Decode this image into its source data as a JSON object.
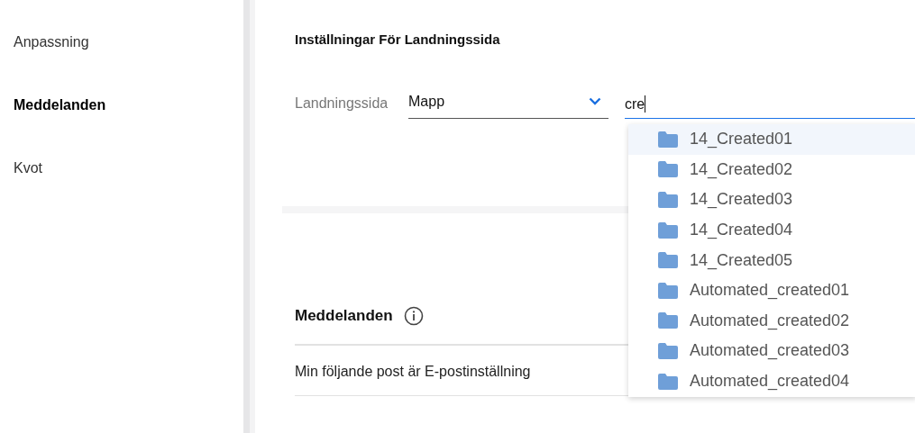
{
  "sidebar": {
    "items": [
      {
        "label": "Anpassning",
        "selected": false
      },
      {
        "label": "Meddelanden",
        "selected": true
      },
      {
        "label": "Kvot",
        "selected": false
      }
    ]
  },
  "landing_settings": {
    "title": "Inställningar För Landningssida",
    "label": "Landningssida",
    "select_value": "Mapp",
    "search_value": "cre"
  },
  "dropdown": {
    "items": [
      {
        "label": "14_Created01",
        "selected": true
      },
      {
        "label": "14_Created02",
        "selected": false
      },
      {
        "label": "14_Created03",
        "selected": false
      },
      {
        "label": "14_Created04",
        "selected": false
      },
      {
        "label": "14_Created05",
        "selected": false
      },
      {
        "label": "Automated_created01",
        "selected": false
      },
      {
        "label": "Automated_created02",
        "selected": false
      },
      {
        "label": "Automated_created03",
        "selected": false
      },
      {
        "label": "Automated_created04",
        "selected": false
      }
    ]
  },
  "notifications": {
    "title": "Meddelanden",
    "rows": [
      "Min följande post är E-postinställning"
    ]
  }
}
